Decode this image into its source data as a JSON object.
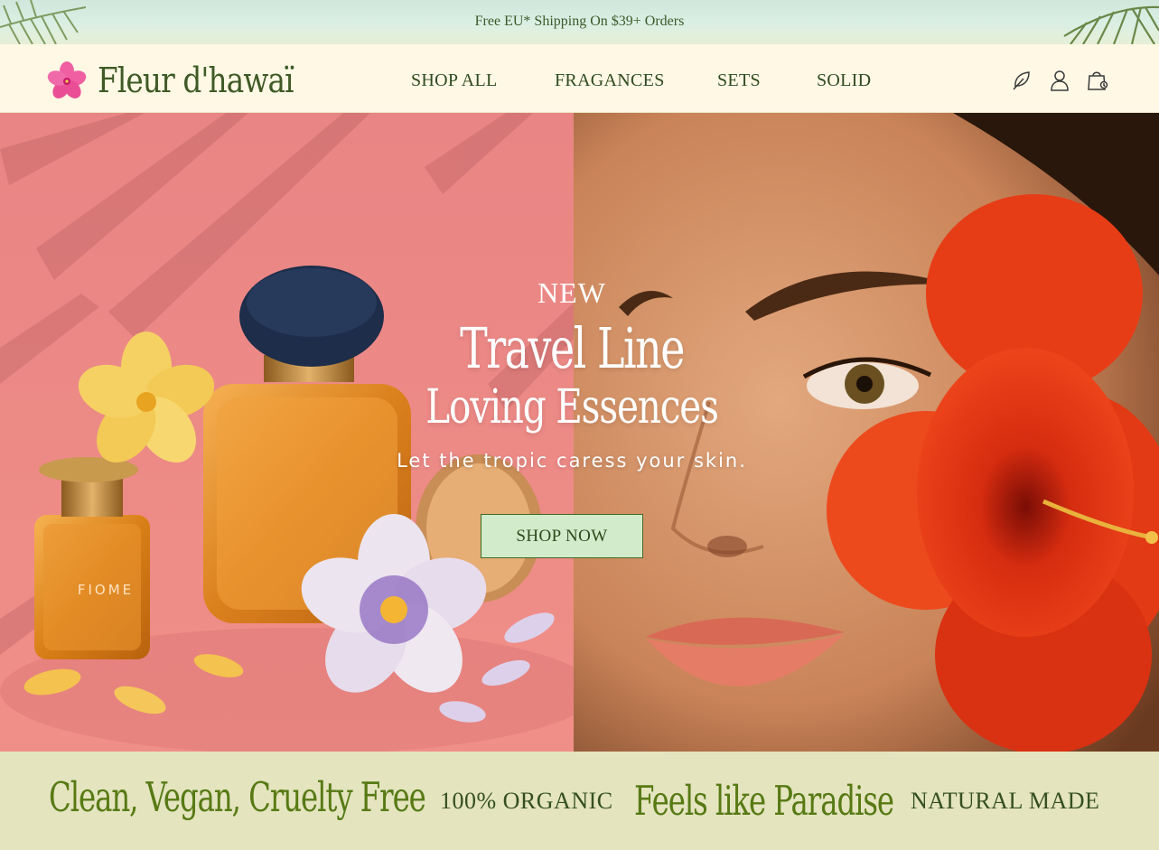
{
  "announcement": {
    "text": "Free EU* Shipping On $39+ Orders"
  },
  "header": {
    "logo_text": "Fleur d'hawaï",
    "nav": [
      {
        "label": "SHOP ALL"
      },
      {
        "label": "FRAGANCES"
      },
      {
        "label": "SETS"
      },
      {
        "label": "SOLID"
      }
    ],
    "icons": [
      "leaf-icon",
      "account-icon",
      "cart-icon"
    ]
  },
  "hero": {
    "kicker": "NEW",
    "title_line1": "Travel Line",
    "title_line2": "Loving Essences",
    "tagline": "Let the tropic caress your skin.",
    "cta_label": "SHOP NOW",
    "bottle_label": "FIOME"
  },
  "band": {
    "items": [
      {
        "text": "Clean, Vegan, Cruelty Free"
      },
      {
        "text": "100% ORGANIC"
      },
      {
        "text": "Feels like Paradise"
      },
      {
        "text": "NATURAL MADE"
      }
    ]
  },
  "colors": {
    "brand_green": "#3f5a25",
    "accent_green": "#577a14",
    "cta_bg": "#d2ebcb",
    "header_bg": "#fef8e5",
    "band_bg": "#e4e4bf",
    "hero_pink": "#ec8a88"
  }
}
